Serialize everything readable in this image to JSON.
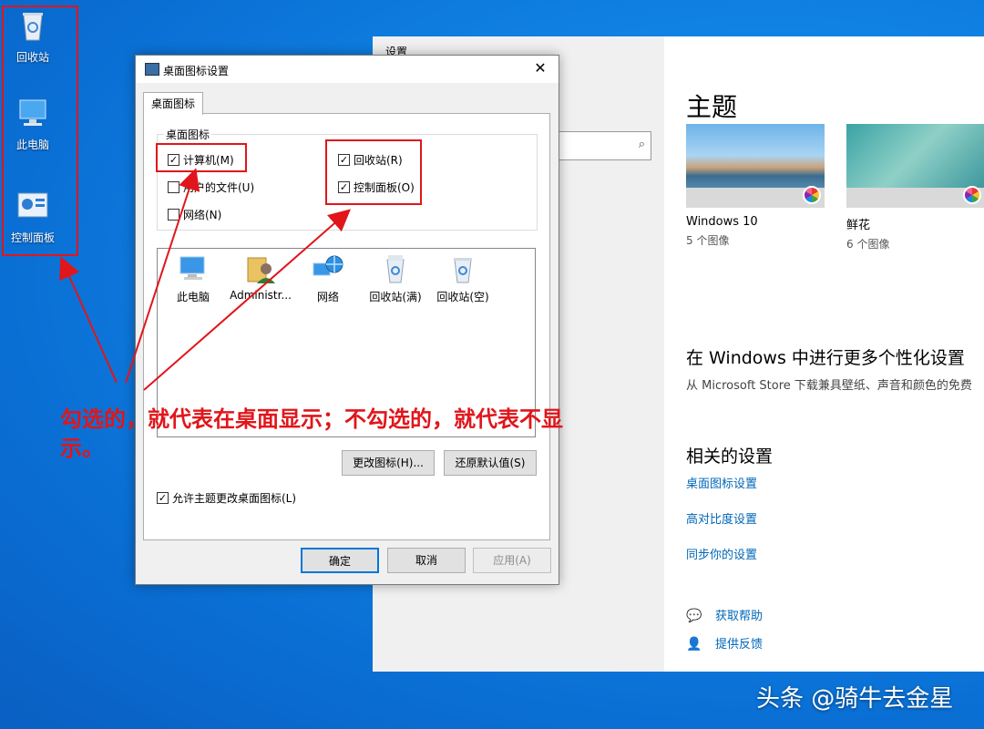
{
  "desktop": {
    "icons": [
      {
        "label": "回收站"
      },
      {
        "label": "此电脑"
      },
      {
        "label": "控制面板"
      }
    ]
  },
  "settings": {
    "window_title": "设置",
    "search_icon": "search-icon",
    "section_title": "主题",
    "themes": [
      {
        "name": "Windows 10",
        "count": "5 个图像"
      },
      {
        "name": "鲜花",
        "count": "6 个图像"
      }
    ],
    "more_title": "在 Windows 中进行更多个性化设置",
    "more_desc": "从 Microsoft Store 下载兼具壁纸、声音和颜色的免费",
    "related_title": "相关的设置",
    "links": [
      "桌面图标设置",
      "高对比度设置",
      "同步你的设置"
    ],
    "help": "获取帮助",
    "feedback": "提供反馈"
  },
  "dialog": {
    "title": "桌面图标设置",
    "close": "✕",
    "tab": "桌面图标",
    "group_label": "桌面图标",
    "checkboxes": [
      {
        "label": "计算机(M)",
        "checked": true
      },
      {
        "label": "用户的文件(U)",
        "checked": false
      },
      {
        "label": "网络(N)",
        "checked": false
      },
      {
        "label": "回收站(R)",
        "checked": true
      },
      {
        "label": "控制面板(O)",
        "checked": true
      }
    ],
    "icon_items": [
      "此电脑",
      "Administr...",
      "网络",
      "回收站(满)",
      "回收站(空)"
    ],
    "change_icon": "更改图标(H)...",
    "restore_default": "还原默认值(S)",
    "allow_theme": "允许主题更改桌面图标(L)",
    "allow_theme_checked": true,
    "ok": "确定",
    "cancel": "取消",
    "apply": "应用(A)"
  },
  "annotation": "勾选的，就代表在桌面显示；不勾选的，就代表不显示。",
  "watermark": "头条 @骑牛去金星",
  "colors": {
    "annotation_red": "#e0161b",
    "link_blue": "#0067b8",
    "primary_border": "#0078d7"
  }
}
